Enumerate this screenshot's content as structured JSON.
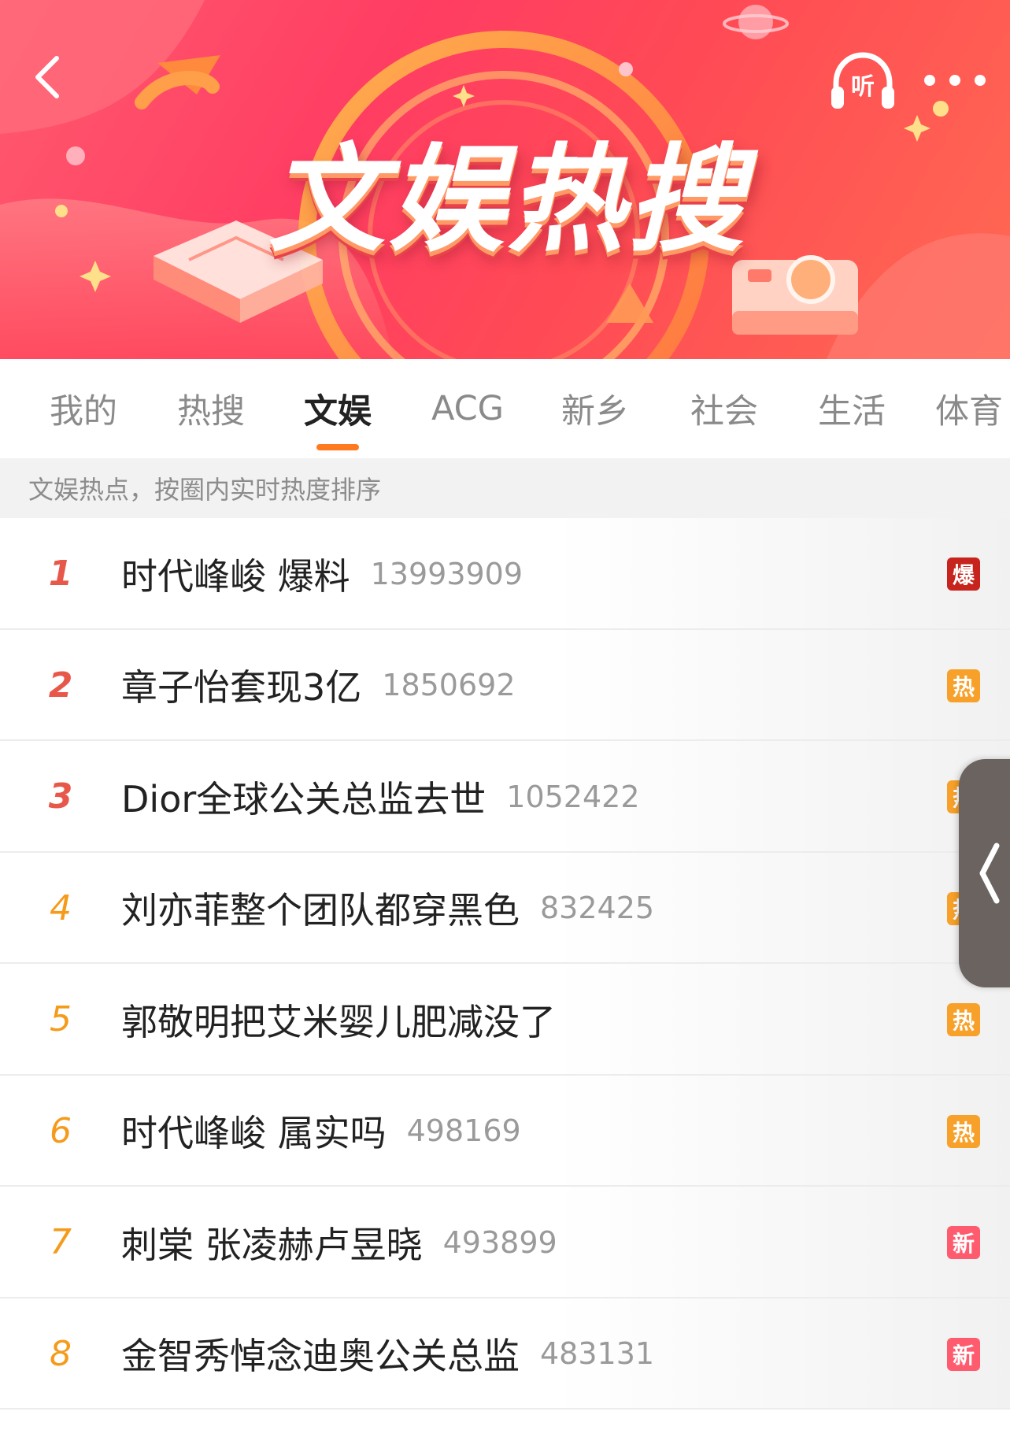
{
  "banner": {
    "title": "文娱热搜",
    "listen_label": "听",
    "back_icon": "chevron-left-icon",
    "more_icon": "more-dots-icon"
  },
  "tabs": [
    {
      "label": "我的",
      "active": false
    },
    {
      "label": "热搜",
      "active": false
    },
    {
      "label": "文娱",
      "active": true
    },
    {
      "label": "ACG",
      "active": false
    },
    {
      "label": "新乡",
      "active": false
    },
    {
      "label": "社会",
      "active": false
    },
    {
      "label": "生活",
      "active": false
    },
    {
      "label": "体育",
      "active": false
    }
  ],
  "subtitle": "文娱热点，按圈内实时热度排序",
  "list": [
    {
      "rank": "1",
      "title": "时代峰峻 爆料",
      "count": "13993909",
      "badge": "爆",
      "badge_color": "#c6241d"
    },
    {
      "rank": "2",
      "title": "章子怡套现3亿",
      "count": "1850692",
      "badge": "热",
      "badge_color": "#f7a12a"
    },
    {
      "rank": "3",
      "title": "Dior全球公关总监去世",
      "count": "1052422",
      "badge": "热",
      "badge_color": "#f7a12a"
    },
    {
      "rank": "4",
      "title": "刘亦菲整个团队都穿黑色",
      "count": "832425",
      "badge": "热",
      "badge_color": "#f7a12a"
    },
    {
      "rank": "5",
      "title": "郭敬明把艾米婴儿肥减没了",
      "count": "",
      "badge": "热",
      "badge_color": "#f7a12a"
    },
    {
      "rank": "6",
      "title": "时代峰峻 属实吗",
      "count": "498169",
      "badge": "热",
      "badge_color": "#f7a12a"
    },
    {
      "rank": "7",
      "title": "刺棠 张凌赫卢昱晓",
      "count": "493899",
      "badge": "新",
      "badge_color": "#ff5b6e"
    },
    {
      "rank": "8",
      "title": "金智秀悼念迪奥公关总监",
      "count": "483131",
      "badge": "新",
      "badge_color": "#ff5b6e"
    }
  ],
  "colors": {
    "accent": "#ff7a1f",
    "rank_top": "#e8584a",
    "rank_mid": "#f59b1b"
  }
}
